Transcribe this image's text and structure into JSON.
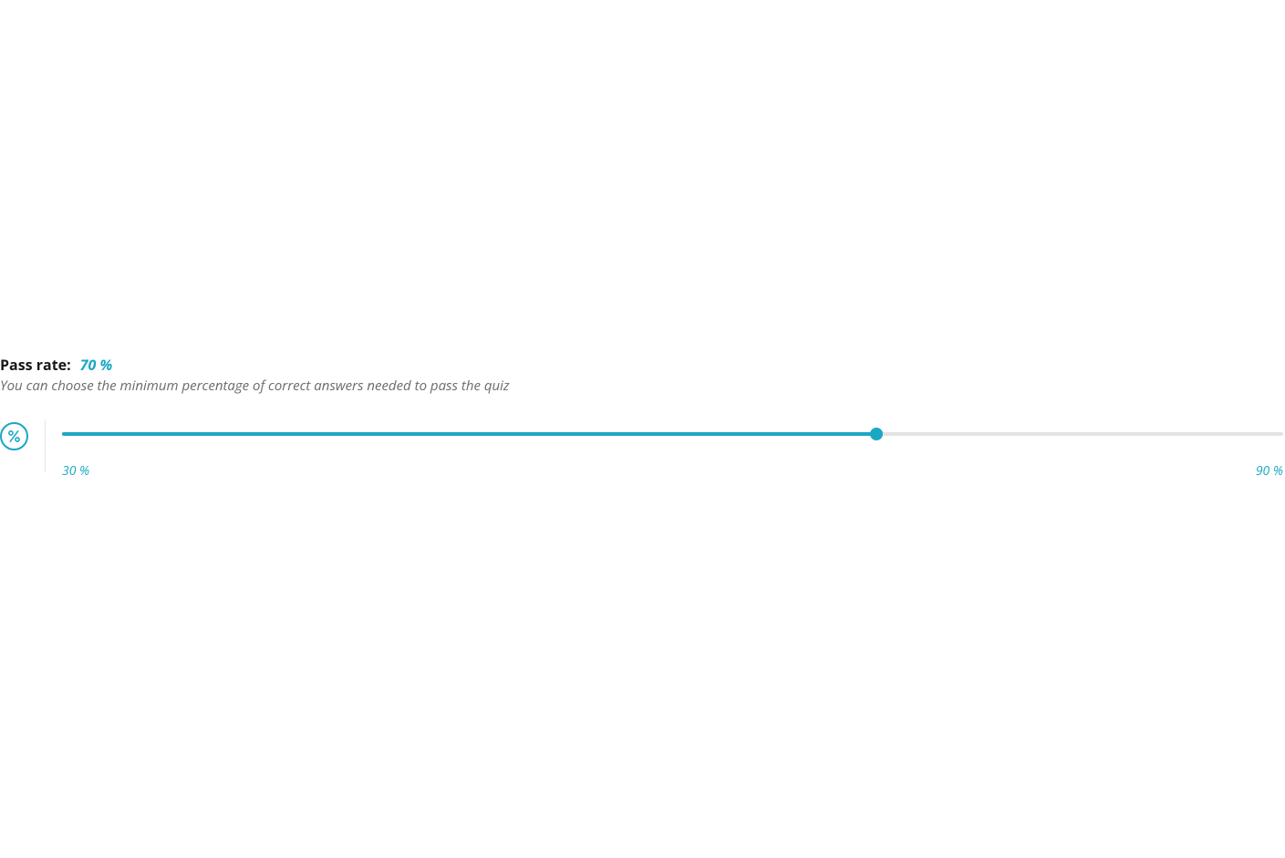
{
  "passRate": {
    "label": "Pass rate:",
    "value": "70 %",
    "valueNumeric": 70,
    "subtitle": "You can choose the minimum percentage of correct answers needed to pass the quiz",
    "slider": {
      "min": 30,
      "max": 90,
      "minLabel": "30 %",
      "maxLabel": "90 %",
      "current": 70
    }
  },
  "colors": {
    "accent": "#1ba7c4",
    "trackEmpty": "#e3e3e3",
    "textMuted": "#6b6b6b"
  }
}
